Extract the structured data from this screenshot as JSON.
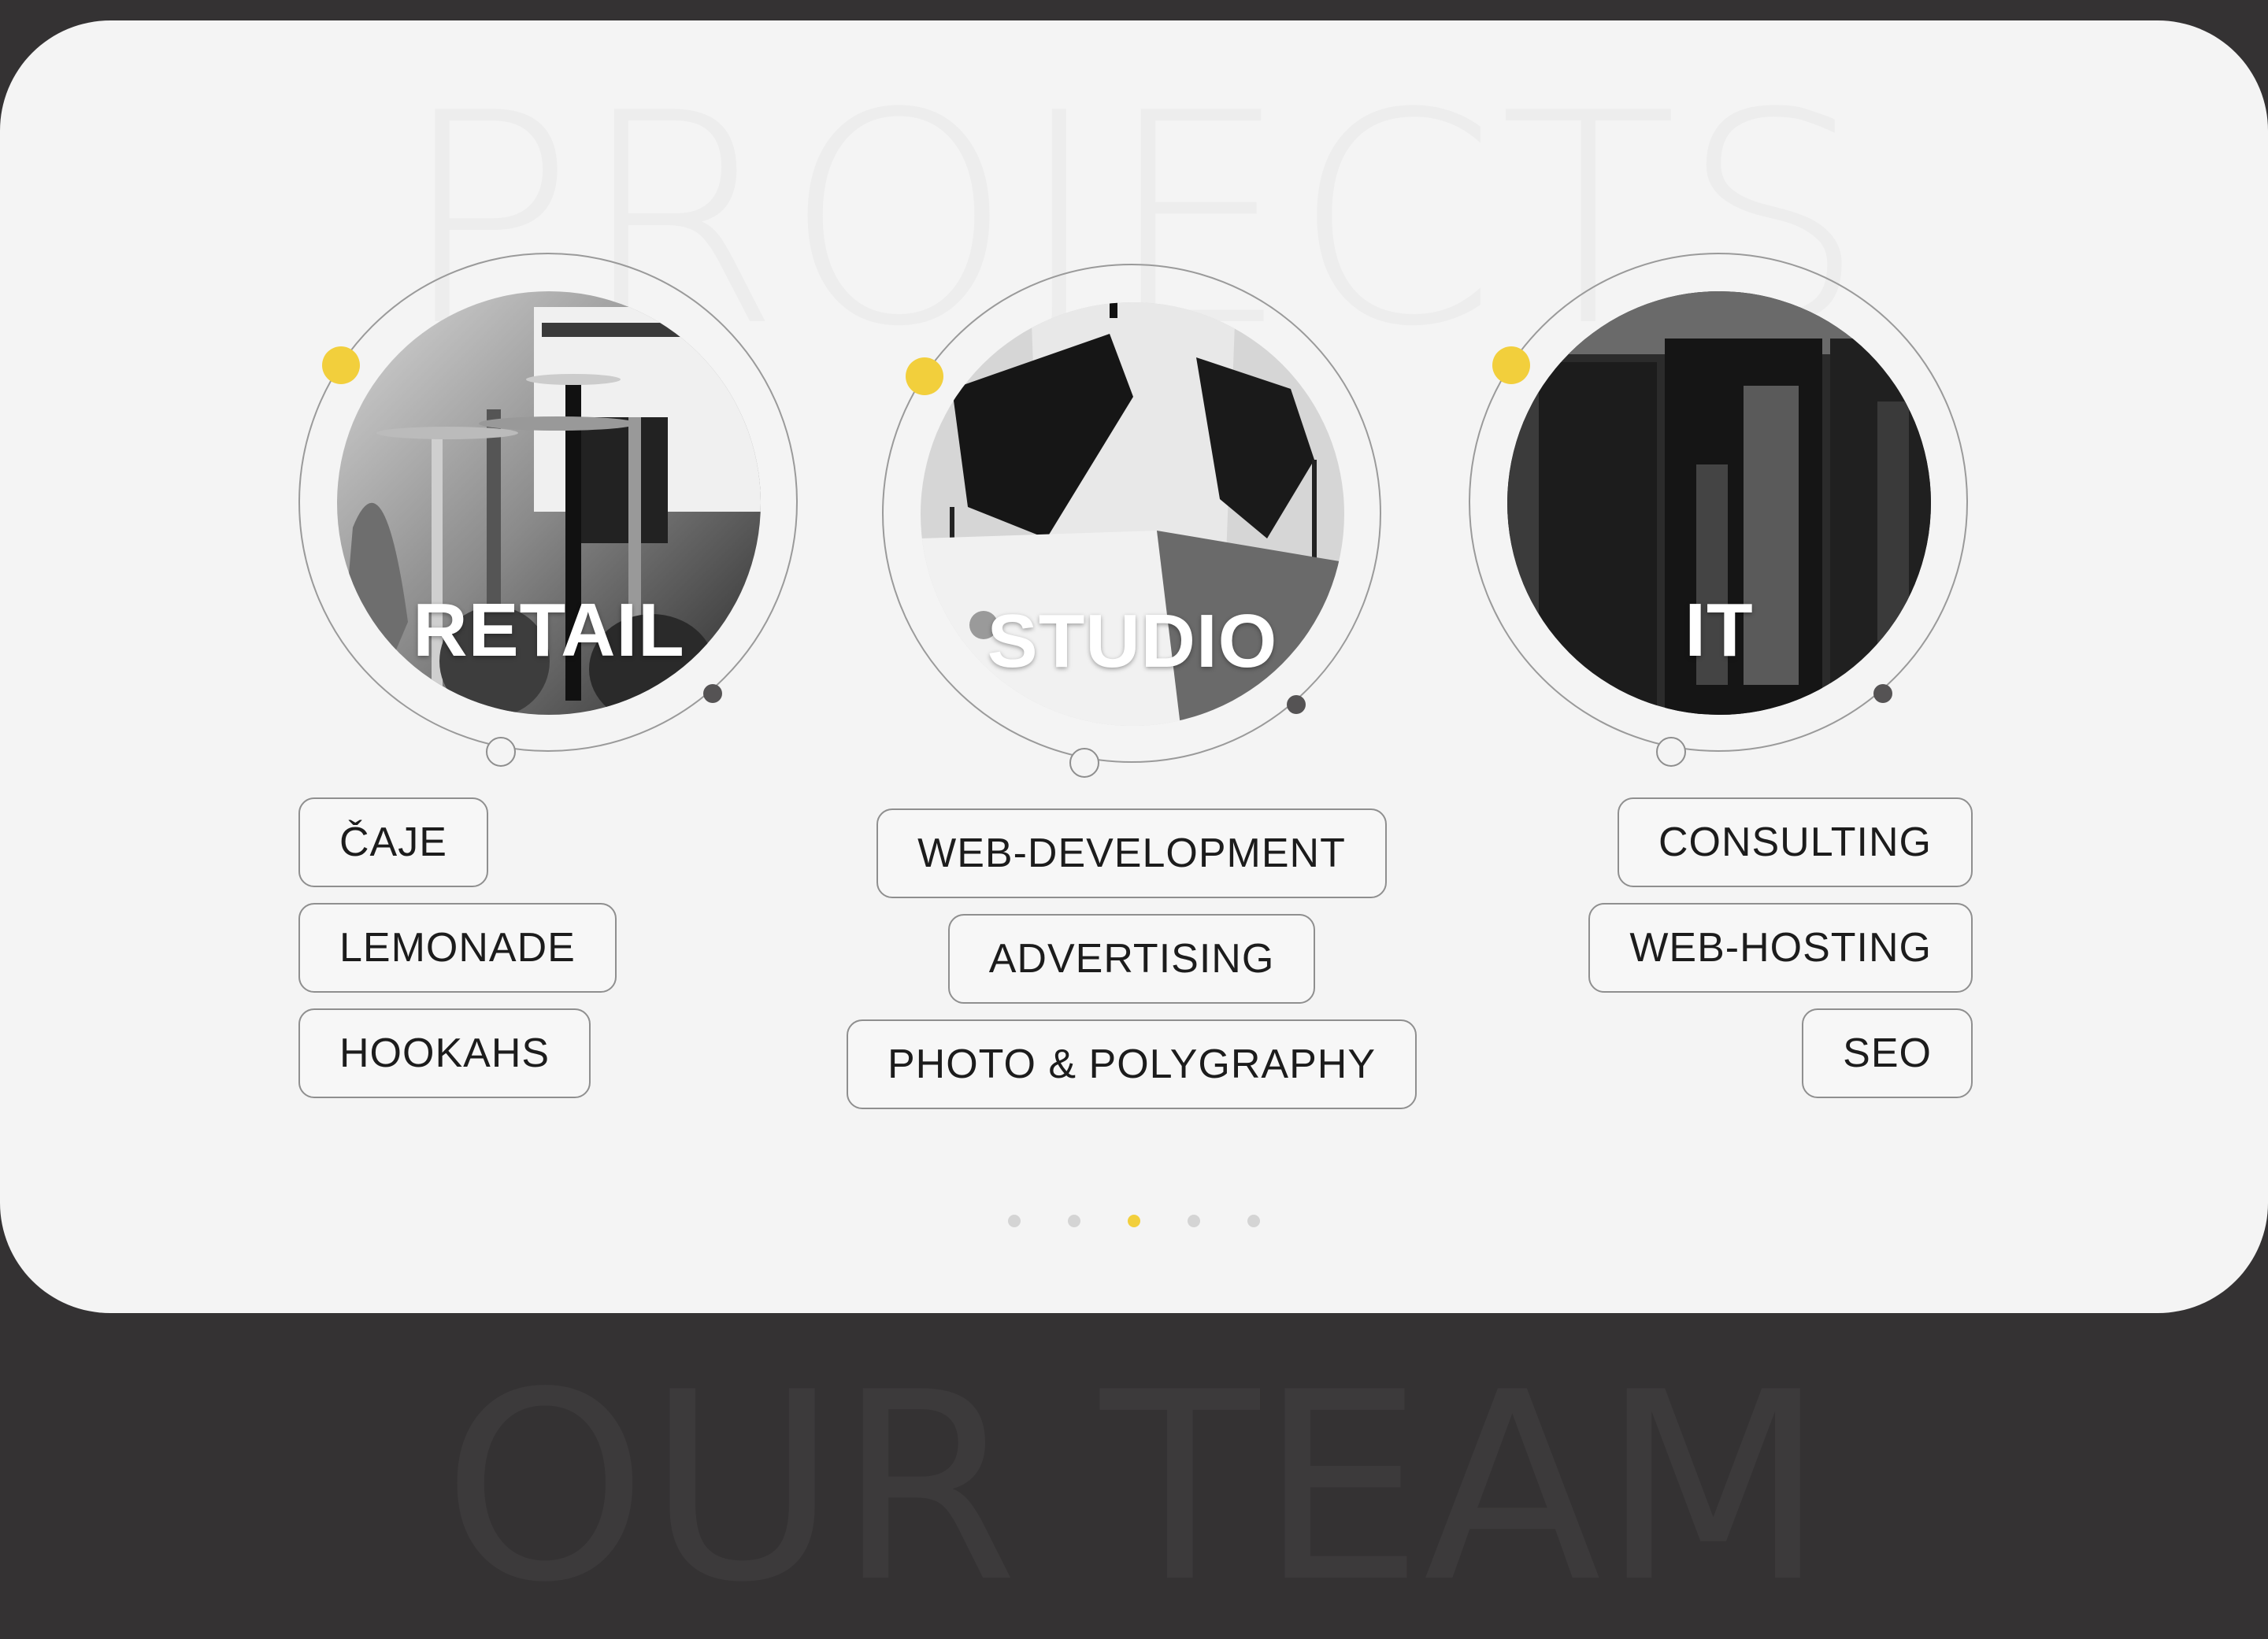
{
  "section": {
    "title": "PROJECTS",
    "next_title": "OUR TEAM"
  },
  "projects": [
    {
      "label": "RETAIL",
      "tags": [
        "ČAJE",
        "LEMONADE",
        "HOOKAHS"
      ]
    },
    {
      "label": "STUDIO",
      "tags": [
        "WEB-DEVELOPMENT",
        "ADVERTISING",
        "PHOTO & POLYGRAPHY"
      ]
    },
    {
      "label": "IT",
      "tags": [
        "CONSULTING",
        "WEB-HOSTING",
        "SEO"
      ]
    }
  ],
  "pager": {
    "count": 5,
    "active_index": 3
  },
  "colors": {
    "accent": "#f2cf3c",
    "background": "#343233",
    "panel": "#f4f4f4"
  }
}
